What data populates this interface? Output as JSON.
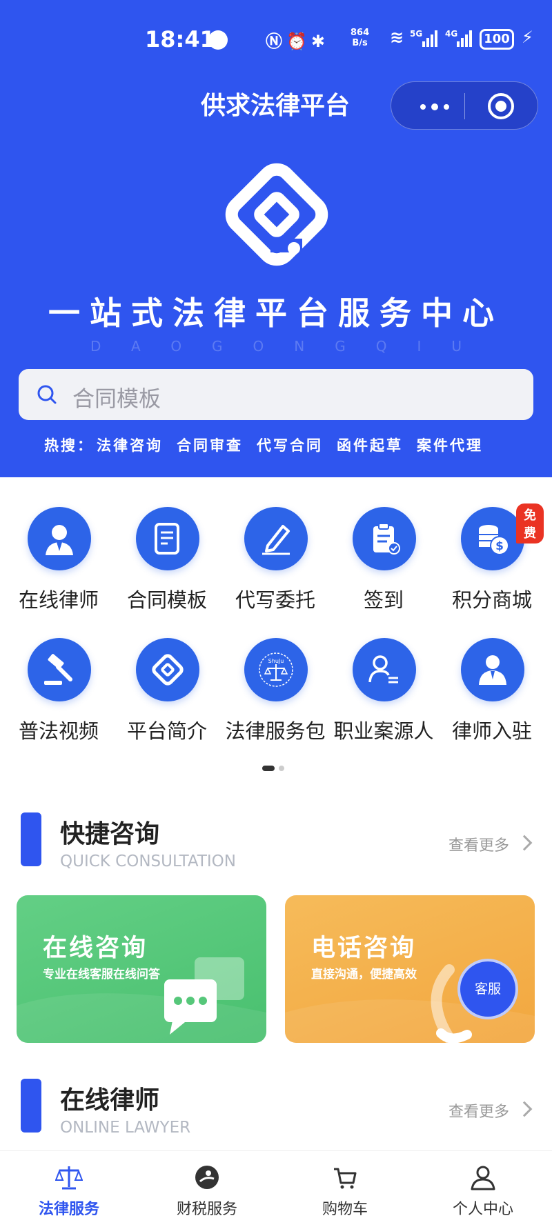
{
  "status_bar": {
    "time": "18:41",
    "net_speed_value": "864",
    "net_speed_unit": "B/s",
    "signal_5g": "5G",
    "signal_4g": "4G",
    "battery": "100"
  },
  "navbar": {
    "title": "供求法律平台"
  },
  "hero": {
    "slogan": "一站式法律平台服务中心",
    "pinyin": "DAOGONGQIU"
  },
  "search": {
    "placeholder": "合同模板"
  },
  "hot_search": {
    "label": "热搜：",
    "items": [
      "法律咨询",
      "合同审查",
      "代写合同",
      "函件起草",
      "案件代理"
    ]
  },
  "grid": {
    "items": [
      {
        "label": "在线律师",
        "icon": "lawyer-avatar-icon"
      },
      {
        "label": "合同模板",
        "icon": "document-icon"
      },
      {
        "label": "代写委托",
        "icon": "pen-icon"
      },
      {
        "label": "签到",
        "icon": "clipboard-check-icon"
      },
      {
        "label": "积分商城",
        "icon": "coins-icon",
        "badge": "免费"
      },
      {
        "label": "普法视频",
        "icon": "gavel-icon"
      },
      {
        "label": "平台简介",
        "icon": "platform-logo-icon"
      },
      {
        "label": "法律服务包",
        "icon": "scales-emblem-icon",
        "emblem_text": "ShuJu"
      },
      {
        "label": "职业案源人",
        "icon": "person-list-icon"
      },
      {
        "label": "律师入驻",
        "icon": "lawyer-suit-icon"
      }
    ]
  },
  "quick": {
    "title": "快捷咨询",
    "subtitle": "QUICK CONSULTATION",
    "more": "查看更多",
    "cards": [
      {
        "title": "在线咨询",
        "desc": "专业在线客服在线问答",
        "color": "#56c77a"
      },
      {
        "title": "电话咨询",
        "desc": "直接沟通，便捷高效",
        "badge": "客服",
        "color": "#f4b04c"
      }
    ]
  },
  "online_lawyer": {
    "title": "在线律师",
    "subtitle": "ONLINE LAWYER",
    "more": "查看更多"
  },
  "tabbar": {
    "tabs": [
      {
        "label": "法律服务",
        "active": true
      },
      {
        "label": "财税服务"
      },
      {
        "label": "购物车"
      },
      {
        "label": "个人中心"
      }
    ]
  },
  "colors": {
    "primary": "#2f55ef",
    "badge": "#ea3323"
  }
}
